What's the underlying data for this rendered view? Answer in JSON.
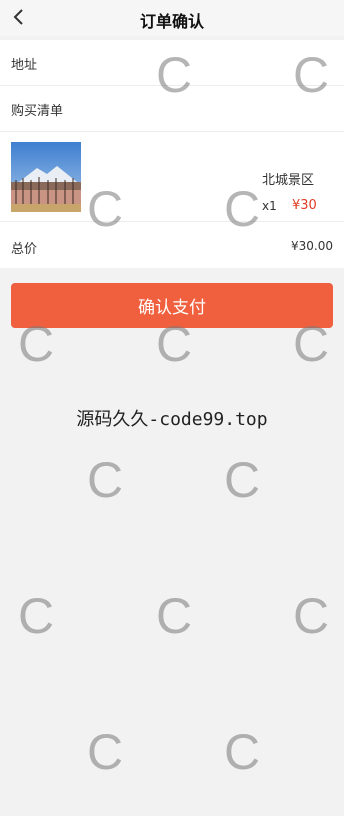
{
  "header": {
    "title": "订单确认",
    "back_icon": "chevron-left-icon"
  },
  "address": {
    "label": "地址"
  },
  "purchase_list": {
    "label": "购买清单"
  },
  "item": {
    "name": "北城景区",
    "quantity": "x1",
    "price": "¥30"
  },
  "total": {
    "label": "总价",
    "value": "¥30.00"
  },
  "pay_button": {
    "label": "确认支付"
  },
  "brand": {
    "text": "源码久久-code99.top"
  },
  "watermark": {
    "glyph": "C"
  },
  "colors": {
    "accent": "#f0603e",
    "price": "#e03c24",
    "background": "#f2f2f2"
  }
}
